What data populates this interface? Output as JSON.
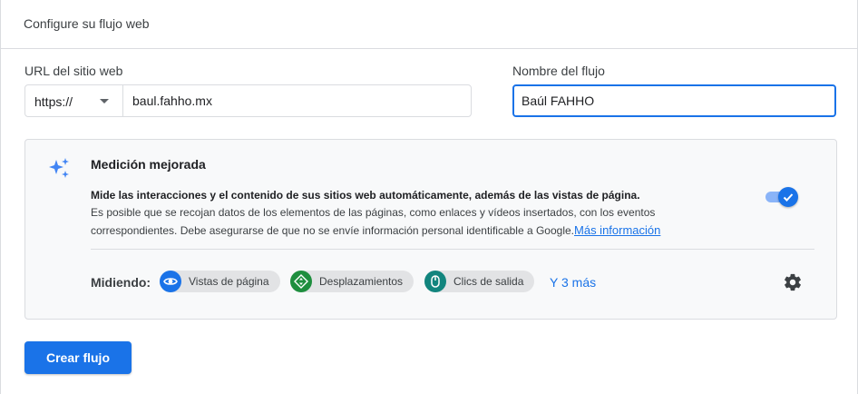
{
  "header": {
    "title": "Configure su flujo web"
  },
  "form": {
    "url_label": "URL del sitio web",
    "protocol_value": "https://",
    "url_value": "baul.fahho.mx",
    "name_label": "Nombre del flujo",
    "name_value": "Baúl FAHHO"
  },
  "enhanced": {
    "icon": "sparkle-icon",
    "title": "Medición mejorada",
    "desc_bold": "Mide las interacciones y el contenido de sus sitios web automáticamente, además de las vistas de página.",
    "desc_rest": "Es posible que se recojan datos de los elementos de las páginas, como enlaces y vídeos insertados, con los eventos correspondientes. Debe asegurarse de que no se envíe información personal identificable a Google.",
    "link": "Más información",
    "toggle_on": true,
    "measuring_label": "Midiendo:",
    "chips": [
      {
        "label": "Vistas de página",
        "icon": "eye-icon",
        "color": "#1a73e8"
      },
      {
        "label": "Desplazamientos",
        "icon": "scroll-icon",
        "color": "#1e8e3e"
      },
      {
        "label": "Clics de salida",
        "icon": "mouse-icon",
        "color": "#12857e"
      }
    ],
    "more": "Y 3 más",
    "settings_icon": "gear-icon"
  },
  "actions": {
    "create": "Crear flujo"
  },
  "colors": {
    "primary": "#1a73e8",
    "border": "#dadce0",
    "panel_bg": "#f8f9fa"
  }
}
